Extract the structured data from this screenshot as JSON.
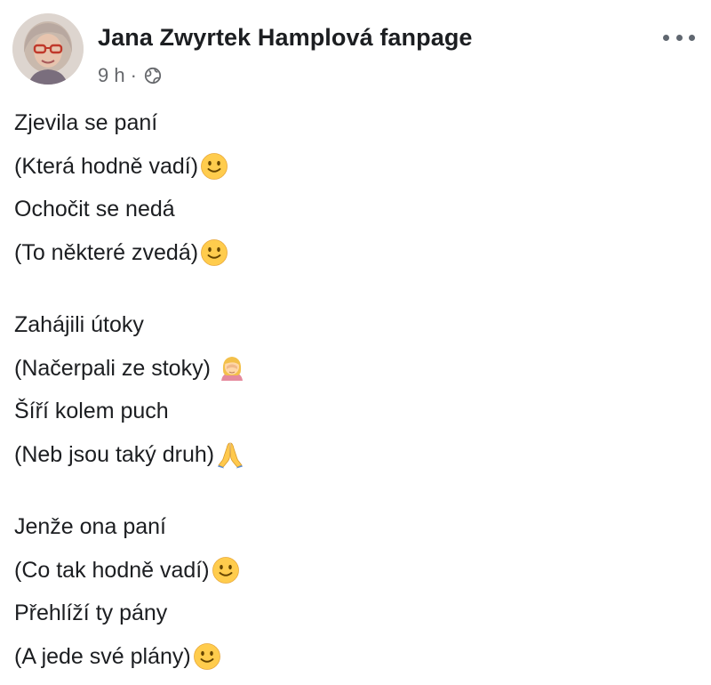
{
  "post": {
    "author": "Jana Zwyrtek Hamplová fanpage",
    "time": "9 h",
    "separator": "·",
    "visibility_icon": "globe-icon",
    "menu_icon": "more-options-icon",
    "colors": {
      "text": "#1c1e21",
      "meta": "#65676b",
      "emoji_yellow": "#ffcc4d",
      "emoji_face": "#664500"
    },
    "stanzas": [
      {
        "lines": [
          {
            "text": "Zjevila se paní",
            "emoji": ""
          },
          {
            "text": "(Která hodně vadí)",
            "emoji": "slightly-smiling-face-icon"
          },
          {
            "text": "Ochočit se nedá",
            "emoji": ""
          },
          {
            "text": "(To některé zvedá)",
            "emoji": "slightly-smiling-face-icon"
          }
        ]
      },
      {
        "lines": [
          {
            "text": "Zahájili útoky",
            "emoji": ""
          },
          {
            "text": "(Načerpali ze stoky) ",
            "emoji": "woman-facepalming-icon"
          },
          {
            "text": "Šíří kolem puch",
            "emoji": ""
          },
          {
            "text": "(Neb jsou taký druh)",
            "emoji": "folded-hands-icon"
          }
        ]
      },
      {
        "lines": [
          {
            "text": "Jenže ona paní",
            "emoji": ""
          },
          {
            "text": "(Co tak hodně vadí)",
            "emoji": "slightly-smiling-face-icon"
          },
          {
            "text": "Přehlíží ty pány",
            "emoji": ""
          },
          {
            "text": "(A jede své plány)",
            "emoji": "slightly-smiling-face-icon"
          }
        ]
      }
    ]
  }
}
